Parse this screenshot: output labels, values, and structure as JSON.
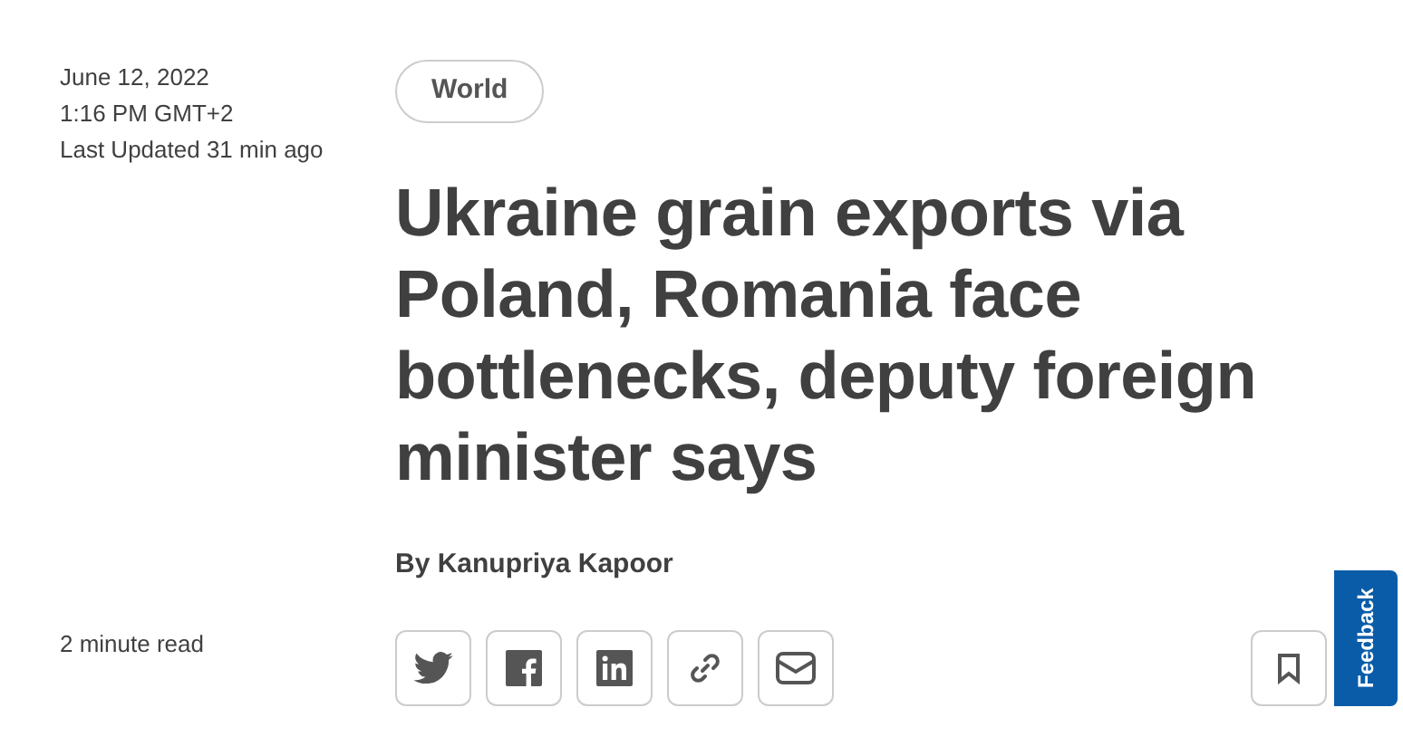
{
  "meta": {
    "date": "June 12, 2022",
    "time": "1:16 PM GMT+2",
    "updated": "Last Updated 31 min ago",
    "read_time": "2 minute read"
  },
  "category": "World",
  "headline": "Ukraine grain exports via Poland, Romania face bottlenecks, deputy foreign minister says",
  "byline": "By Kanupriya Kapoor",
  "feedback": "Feedback"
}
